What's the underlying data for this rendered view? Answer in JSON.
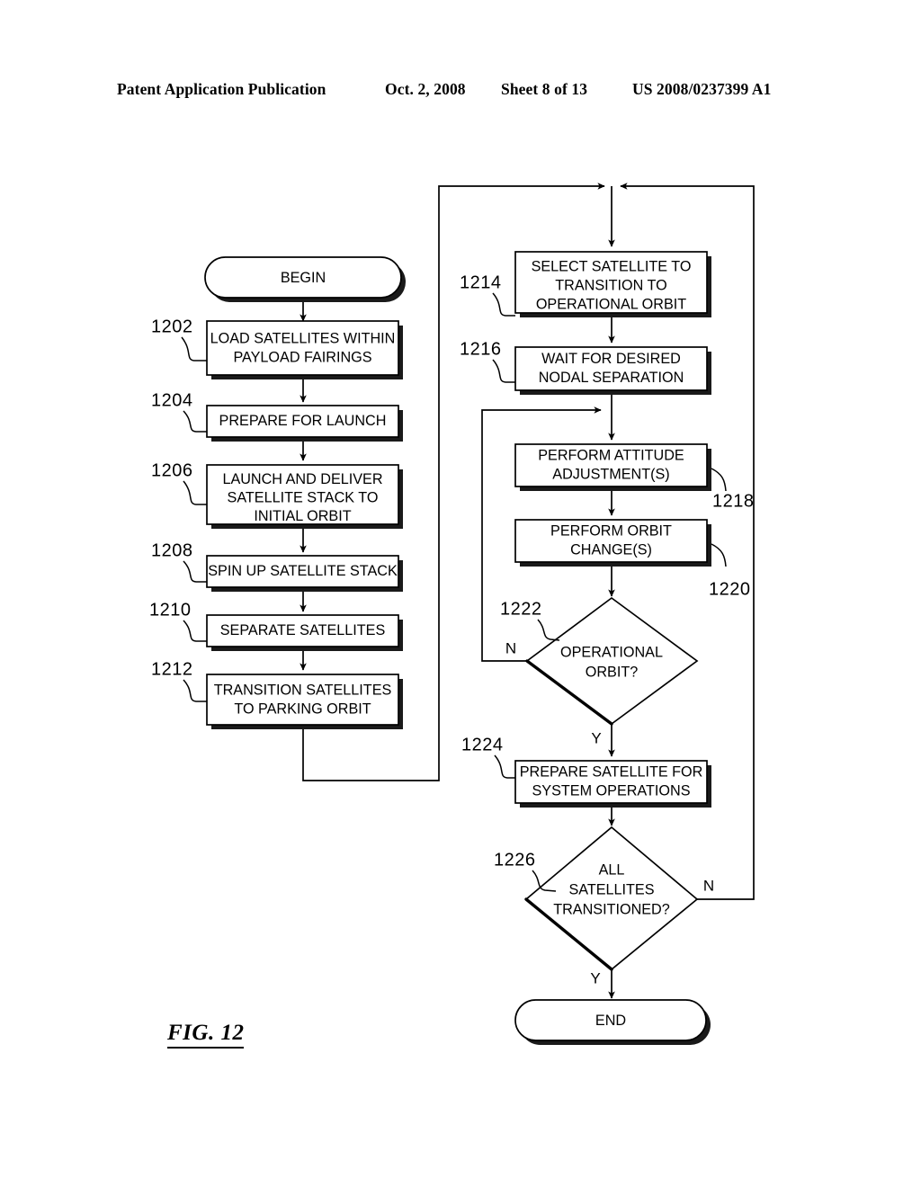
{
  "header": {
    "publication": "Patent Application Publication",
    "date": "Oct. 2, 2008",
    "sheet": "Sheet 8 of 13",
    "patent_number": "US 2008/0237399 A1"
  },
  "figure": {
    "label": "FIG. 12"
  },
  "flowchart": {
    "nodes": [
      {
        "id": "begin",
        "type": "terminator",
        "ref": "",
        "text": "BEGIN"
      },
      {
        "id": "n1202",
        "type": "process",
        "ref": "1202",
        "text": "LOAD SATELLITES WITHIN\nPAYLOAD FAIRINGS",
        "line1": "LOAD SATELLITES WITHIN",
        "line2": "PAYLOAD FAIRINGS",
        "line3": ""
      },
      {
        "id": "n1204",
        "type": "process",
        "ref": "1204",
        "text": "PREPARE FOR LAUNCH",
        "line1": "PREPARE FOR LAUNCH",
        "line2": "",
        "line3": ""
      },
      {
        "id": "n1206",
        "type": "process",
        "ref": "1206",
        "text": "LAUNCH AND DELIVER SATELLITE STACK TO INITIAL ORBIT",
        "line1": "LAUNCH AND DELIVER",
        "line2": "SATELLITE STACK TO",
        "line3": "INITIAL ORBIT"
      },
      {
        "id": "n1208",
        "type": "process",
        "ref": "1208",
        "text": "SPIN UP SATELLITE STACK",
        "line1": "SPIN UP SATELLITE STACK",
        "line2": "",
        "line3": ""
      },
      {
        "id": "n1210",
        "type": "process",
        "ref": "1210",
        "text": "SEPARATE SATELLITES",
        "line1": "SEPARATE SATELLITES",
        "line2": "",
        "line3": ""
      },
      {
        "id": "n1212",
        "type": "process",
        "ref": "1212",
        "text": "TRANSITION SATELLITES TO PARKING ORBIT",
        "line1": "TRANSITION SATELLITES",
        "line2": "TO PARKING ORBIT",
        "line3": ""
      },
      {
        "id": "n1214",
        "type": "process",
        "ref": "1214",
        "text": "SELECT SATELLITE TO TRANSITION TO OPERATIONAL ORBIT",
        "line1": "SELECT SATELLITE TO",
        "line2": "TRANSITION TO",
        "line3": "OPERATIONAL ORBIT"
      },
      {
        "id": "n1216",
        "type": "process",
        "ref": "1216",
        "text": "WAIT FOR DESIRED NODAL SEPARATION",
        "line1": "WAIT FOR DESIRED",
        "line2": "NODAL SEPARATION",
        "line3": ""
      },
      {
        "id": "n1218",
        "type": "process",
        "ref": "1218",
        "text": "PERFORM ATTITUDE ADJUSTMENT(S)",
        "line1": "PERFORM ATTITUDE",
        "line2": "ADJUSTMENT(S)",
        "line3": ""
      },
      {
        "id": "n1220",
        "type": "process",
        "ref": "1220",
        "text": "PERFORM ORBIT CHANGE(S)",
        "line1": "PERFORM ORBIT",
        "line2": "CHANGE(S)",
        "line3": ""
      },
      {
        "id": "n1222",
        "type": "decision",
        "ref": "1222",
        "text": "OPERATIONAL ORBIT?",
        "line1": "OPERATIONAL",
        "line2": "ORBIT?",
        "line3": ""
      },
      {
        "id": "n1224",
        "type": "process",
        "ref": "1224",
        "text": "PREPARE SATELLITE FOR SYSTEM OPERATIONS",
        "line1": "PREPARE SATELLITE FOR",
        "line2": "SYSTEM OPERATIONS",
        "line3": ""
      },
      {
        "id": "n1226",
        "type": "decision",
        "ref": "1226",
        "text": "ALL SATELLITES TRANSITIONED?",
        "line1": "ALL",
        "line2": "SATELLITES",
        "line3": "TRANSITIONED?"
      },
      {
        "id": "end",
        "type": "terminator",
        "ref": "",
        "text": "END"
      }
    ],
    "branch_labels": {
      "d1222_no": "N",
      "d1222_yes": "Y",
      "d1226_no": "N",
      "d1226_yes": "Y"
    }
  },
  "colors": {
    "ink": "#000000",
    "paper": "#ffffff"
  }
}
